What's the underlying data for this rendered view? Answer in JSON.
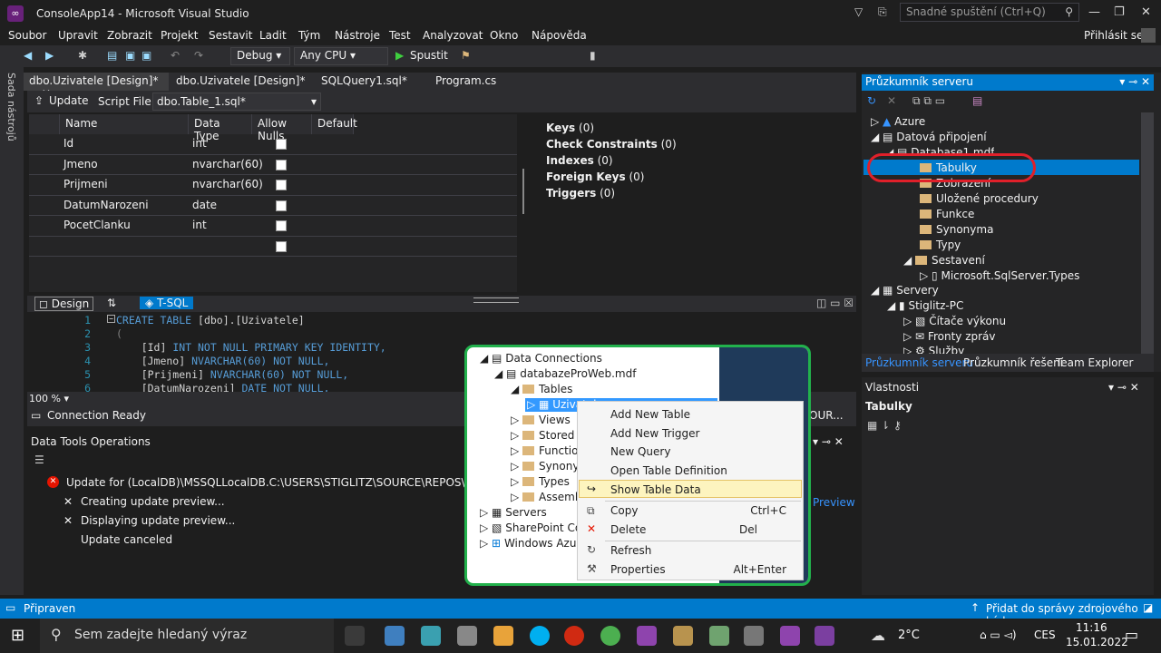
{
  "window": {
    "title": "ConsoleApp14 - Microsoft Visual Studio",
    "quick_launch": "Snadné spuštění (Ctrl+Q)",
    "sign_in": "Přihlásit se"
  },
  "menu": [
    "Soubor",
    "Upravit",
    "Zobrazit",
    "Projekt",
    "Sestavit",
    "Ladit",
    "Tým",
    "Nástroje",
    "Test",
    "Analyzovat",
    "Okno",
    "Nápověda"
  ],
  "toolbar": {
    "config": "Debug",
    "platform": "Any CPU",
    "start": "Spustit"
  },
  "side_strip": "Sada nástrojů",
  "tabs": [
    "dbo.Uzivatele [Design]*",
    "dbo.Uzivatele [Design]*",
    "SQLQuery1.sql*",
    "Program.cs"
  ],
  "designer": {
    "update_label": "Update",
    "script_file_label": "Script File:",
    "script_file": "dbo.Table_1.sql*",
    "columns": [
      "Name",
      "Data Type",
      "Allow Nulls",
      "Default"
    ],
    "rows": [
      {
        "name": "Id",
        "type": "int"
      },
      {
        "name": "Jmeno",
        "type": "nvarchar(60)"
      },
      {
        "name": "Prijmeni",
        "type": "nvarchar(60)"
      },
      {
        "name": "DatumNarozeni",
        "type": "date"
      },
      {
        "name": "PocetClanku",
        "type": "int"
      },
      {
        "name": "",
        "type": ""
      }
    ],
    "keys": [
      {
        "label": "Keys",
        "count": "(0)"
      },
      {
        "label": "Check Constraints",
        "count": "(0)"
      },
      {
        "label": "Indexes",
        "count": "(0)"
      },
      {
        "label": "Foreign Keys",
        "count": "(0)"
      },
      {
        "label": "Triggers",
        "count": "(0)"
      }
    ]
  },
  "panes": {
    "design": "Design",
    "tsql": "T-SQL"
  },
  "code": {
    "lines": [
      "1",
      "2",
      "3",
      "4",
      "5",
      "6"
    ],
    "l1a": "CREATE TABLE ",
    "l1b": "[dbo].[Uzivatele]",
    "l2": "(",
    "l3a": "    [Id] ",
    "l3b": "INT NOT NULL PRIMARY KEY IDENTITY,",
    "l4a": "    [Jmeno] ",
    "l4b": "NVARCHAR(60) NOT NULL,",
    "l5a": "    [Prijmeni] ",
    "l5b": "NVARCHAR(60) NOT NULL,",
    "l6a": "    [DatumNarozeni] ",
    "l6b": "DATE NOT NULL,"
  },
  "zoom": "100 %",
  "connection": "Connection Ready",
  "conn_right": "OUR...",
  "dto": {
    "title": "Data Tools Operations",
    "error": "Update for (LocalDB)\\MSSQLLocalDB.C:\\USERS\\STIGLITZ\\SOURCE\\REPOS\\CONSOLEAPP",
    "steps": [
      "Creating update preview...",
      "Displaying update preview...",
      "Update canceled"
    ],
    "preview_link": "Preview"
  },
  "server_explorer": {
    "title": "Průzkumník serveru",
    "items": [
      "Azure",
      "Datová připojení",
      "Database1.mdf",
      "Tabulky",
      "Zobrazení",
      "Uložené procedury",
      "Funkce",
      "Synonyma",
      "Typy",
      "Sestavení",
      "Microsoft.SqlServer.Types",
      "Servery",
      "Stiglitz-PC",
      "Čítače výkonu",
      "Fronty zpráv",
      "Služby"
    ],
    "tabs": [
      "Průzkumník serveru",
      "Průzkumník řešení",
      "Team Explorer"
    ]
  },
  "properties": {
    "title": "Vlastnosti",
    "object": "Tabulky"
  },
  "inset": {
    "tree": [
      "Data Connections",
      "databazeProWeb.mdf",
      "Tables",
      "Uzivatele",
      "Views",
      "Stored P",
      "Functio",
      "Synony",
      "Types",
      "Assemb",
      "Servers",
      "SharePoint Con",
      "Windows Azure"
    ],
    "menu": [
      {
        "label": "Add New Table",
        "shortcut": ""
      },
      {
        "label": "Add New Trigger",
        "shortcut": ""
      },
      {
        "label": "New Query",
        "shortcut": ""
      },
      {
        "label": "Open Table Definition",
        "shortcut": ""
      },
      {
        "label": "Show Table Data",
        "shortcut": ""
      },
      {
        "label": "Copy",
        "shortcut": "Ctrl+C"
      },
      {
        "label": "Delete",
        "shortcut": "Del"
      },
      {
        "label": "Refresh",
        "shortcut": ""
      },
      {
        "label": "Properties",
        "shortcut": "Alt+Enter"
      }
    ]
  },
  "status": {
    "left": "Připraven",
    "right": "Přidat do správy zdrojového kódu"
  },
  "taskbar": {
    "search": "Sem zadejte hledaný výraz",
    "temp": "2°C",
    "lang": "CES",
    "time": "11:16",
    "date": "15.01.2022"
  },
  "colors": {
    "accent": "#007acc",
    "highlight_ring": "#e0202a",
    "inset_border": "#22b14c"
  }
}
